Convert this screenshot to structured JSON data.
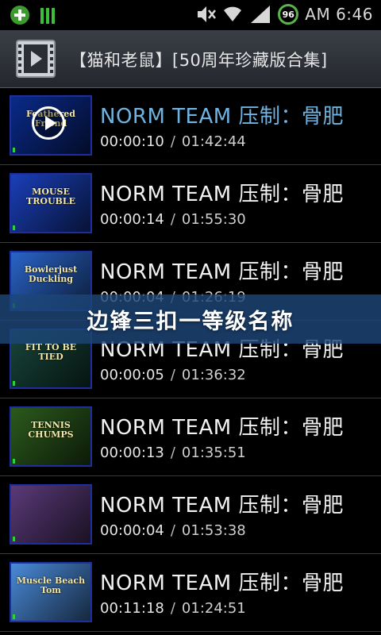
{
  "status_bar": {
    "battery_level": "96",
    "time": "AM 6:46",
    "icons": [
      "add-icon",
      "signal-bars-icon",
      "mute-icon",
      "wifi-icon",
      "cell-signal-icon",
      "battery-icon"
    ]
  },
  "app_bar": {
    "icon": "video-player-icon",
    "title": "【猫和老鼠】[50周年珍藏版合集]"
  },
  "videos": [
    {
      "title": "NORM TEAM  压制：骨肥",
      "position": "00:00:10",
      "separator": "/",
      "duration": "01:42:44",
      "thumb_caption": "Feathered Friend",
      "thumb_bg": "#0a2a8a",
      "active": true
    },
    {
      "title": "NORM TEAM  压制：骨肥",
      "position": "00:00:14",
      "separator": "/",
      "duration": "01:55:30",
      "thumb_caption": "MOUSE TROUBLE",
      "thumb_bg": "#1a3fb8",
      "active": false
    },
    {
      "title": "NORM TEAM  压制：骨肥",
      "position": "00:00:04",
      "separator": "/",
      "duration": "01:26:19",
      "thumb_caption": "Bowlerjust Duckling",
      "thumb_bg": "#2a64c8",
      "active": false
    },
    {
      "title": "NORM TEAM  压制：骨肥",
      "position": "00:00:05",
      "separator": "/",
      "duration": "01:36:32",
      "thumb_caption": "FIT TO BE TIED",
      "thumb_bg": "#17453a",
      "active": false
    },
    {
      "title": "NORM TEAM  压制：骨肥",
      "position": "00:00:13",
      "separator": "/",
      "duration": "01:35:51",
      "thumb_caption": "TENNIS CHUMPS",
      "thumb_bg": "#2b5a1c",
      "active": false
    },
    {
      "title": "NORM TEAM  压制：骨肥",
      "position": "00:00:04",
      "separator": "/",
      "duration": "01:53:38",
      "thumb_caption": "",
      "thumb_bg": "#5a3a78",
      "active": false
    },
    {
      "title": "NORM TEAM  压制：骨肥",
      "position": "00:11:18",
      "separator": "/",
      "duration": "01:24:51",
      "thumb_caption": "Muscle Beach Tom",
      "thumb_bg": "#4a8ad8",
      "active": false
    }
  ],
  "overlay_banner": "边锋三扣一等级名称",
  "colors": {
    "active_title": "#6fb3e0",
    "progress_green": "#2fd13a",
    "banner_bg": "#1c4678"
  }
}
